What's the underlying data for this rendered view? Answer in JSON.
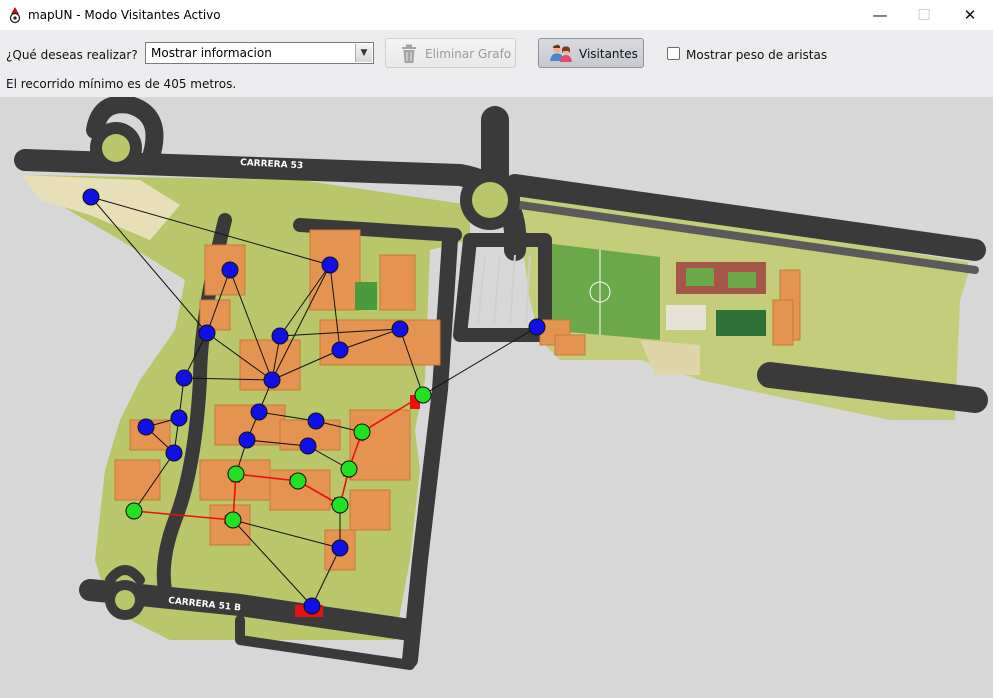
{
  "window": {
    "title": "mapUN - Modo Visitantes Activo",
    "minimize_glyph": "—",
    "maximize_glyph": "☐",
    "close_glyph": "✕",
    "app_icon": "map-pin-icon"
  },
  "toolbar": {
    "question_label": "¿Qué deseas realizar?",
    "action_select": {
      "value": "Mostrar informacion",
      "arrow": "▼"
    },
    "delete_graph_button": {
      "label": "Eliminar Grafo",
      "icon": "trash-icon",
      "enabled": false
    },
    "visitors_button": {
      "label": "Visitantes",
      "icon": "people-icon",
      "pressed": true
    },
    "show_weights_checkbox": {
      "label": "Mostrar peso de aristas",
      "checked": false
    }
  },
  "status": {
    "message": "El recorrido mínimo es de 405 metros."
  },
  "map": {
    "street_labels": [
      "CARRERA 53",
      "CARRERA 51 B"
    ],
    "colors": {
      "node_default": "#1010e6",
      "node_route": "#22e022",
      "edge_default": "#111111",
      "edge_route": "#e81010",
      "green_area": "#b9c66a",
      "building": "#e49450",
      "road": "#3a3a3a"
    }
  }
}
